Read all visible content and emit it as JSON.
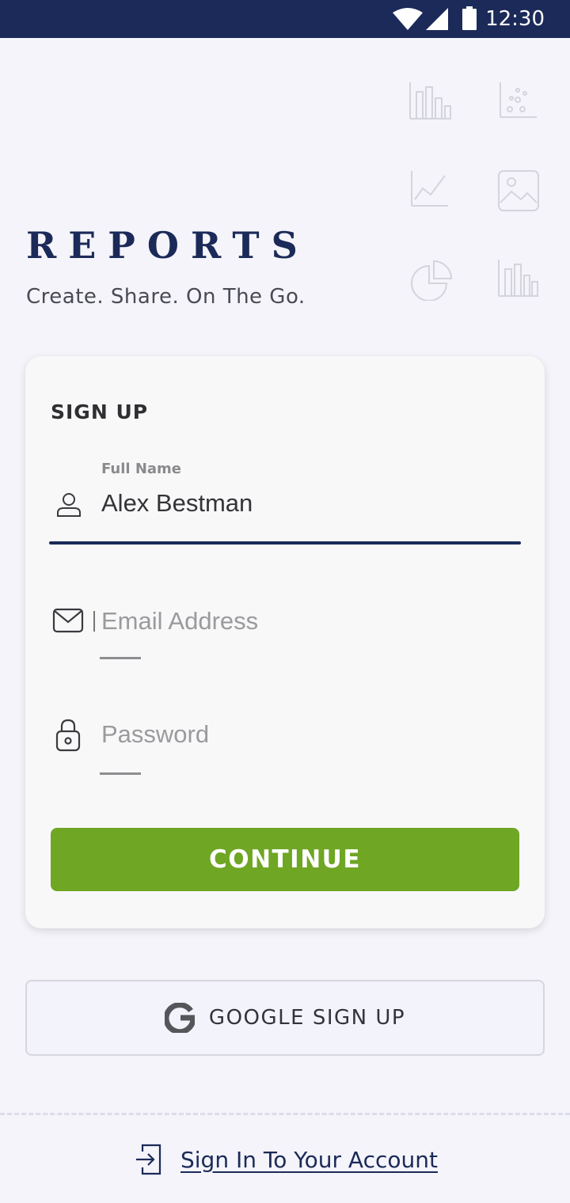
{
  "status_bar": {
    "time": "12:30",
    "icons": [
      "wifi-icon",
      "signal-icon",
      "battery-icon"
    ],
    "background": "#1b2a58"
  },
  "decorative_icons": [
    "bar-chart-icon",
    "scatter-chart-icon",
    "line-chart-icon",
    "image-icon",
    "pie-chart-icon",
    "bar-chart-icon"
  ],
  "brand": {
    "title": "REPORTS",
    "tagline": "Create. Share. On The Go.",
    "color": "#1b2a58"
  },
  "signup_card": {
    "title": "SIGN UP",
    "full_name": {
      "label": "Full Name",
      "value": "Alex Bestman",
      "icon": "user-icon"
    },
    "email": {
      "placeholder": "Email Address",
      "value": "",
      "icon": "mail-icon"
    },
    "password": {
      "placeholder": "Password",
      "value": "",
      "icon": "lock-icon"
    },
    "continue_label": "CONTINUE",
    "continue_color": "#6fa624"
  },
  "google_button": {
    "label": "GOOGLE SIGN UP",
    "icon": "google-icon"
  },
  "signin": {
    "label": "Sign In To Your Account",
    "icon": "sign-in-icon"
  }
}
